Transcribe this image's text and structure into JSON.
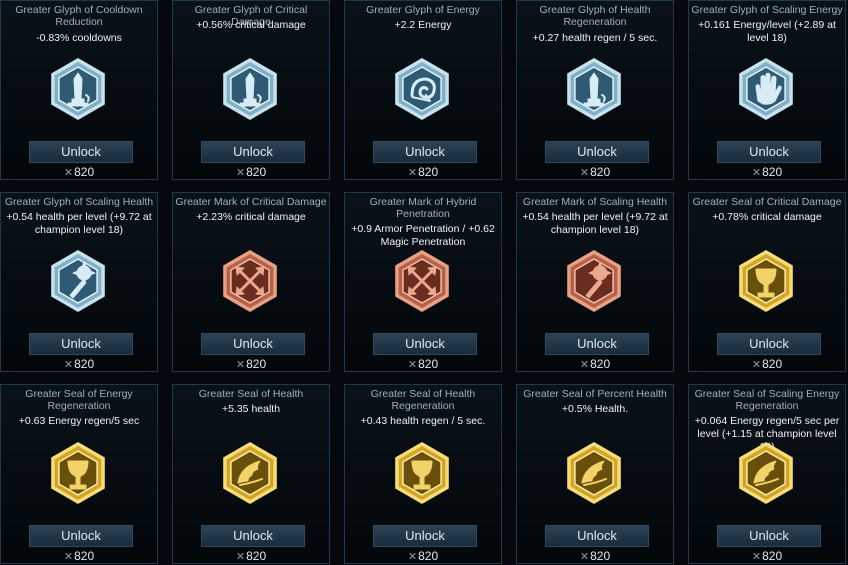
{
  "currency_symbol": "✕",
  "colors": {
    "glyph": "#8fc3d9",
    "mark": "#c26a4a",
    "seal": "#d4a92a"
  },
  "runes": [
    {
      "title": "Greater Glyph of Cooldown Reduction",
      "desc": "-0.83% cooldowns",
      "type": "glyph",
      "icon": "lighthouse-icon",
      "button": "Unlock",
      "price": "820"
    },
    {
      "title": "Greater Glyph of Critical Damage",
      "desc": "+0.56% critical damage",
      "type": "glyph",
      "icon": "lighthouse-icon",
      "button": "Unlock",
      "price": "820"
    },
    {
      "title": "Greater Glyph of Energy",
      "desc": "+2.2 Energy",
      "type": "glyph",
      "icon": "swirl-icon",
      "button": "Unlock",
      "price": "820"
    },
    {
      "title": "Greater Glyph of Health Regeneration",
      "desc": "+0.27 health regen / 5 sec.",
      "type": "glyph",
      "icon": "lighthouse-icon",
      "button": "Unlock",
      "price": "820"
    },
    {
      "title": "Greater Glyph of Scaling Energy",
      "desc": "+0.161 Energy/level (+2.89 at level 18)",
      "type": "glyph",
      "icon": "hand-icon",
      "button": "Unlock",
      "price": "820"
    },
    {
      "title": "Greater Glyph of Scaling Health",
      "desc": "+0.54 health per level (+9.72 at champion level 18)",
      "type": "glyph",
      "icon": "mace-icon",
      "button": "Unlock",
      "price": "820"
    },
    {
      "title": "Greater Mark of Critical Damage",
      "desc": "+2.23% critical damage",
      "type": "mark",
      "icon": "crossed-arrows-icon",
      "button": "Unlock",
      "price": "820"
    },
    {
      "title": "Greater Mark of Hybrid Penetration",
      "desc": "+0.9 Armor Penetration / +0.62 Magic Penetration",
      "type": "mark",
      "icon": "crossed-arrows-icon",
      "button": "Unlock",
      "price": "820"
    },
    {
      "title": "Greater Mark of Scaling Health",
      "desc": "+0.54 health per level (+9.72 at champion level 18)",
      "type": "mark",
      "icon": "mace-icon",
      "button": "Unlock",
      "price": "820"
    },
    {
      "title": "Greater Seal of Critical Damage",
      "desc": "+0.78% critical damage",
      "type": "seal",
      "icon": "chalice-icon",
      "button": "Unlock",
      "price": "820"
    },
    {
      "title": "Greater Seal of Energy Regeneration",
      "desc": "+0.63 Energy regen/5 sec",
      "type": "seal",
      "icon": "chalice-icon",
      "button": "Unlock",
      "price": "820"
    },
    {
      "title": "Greater Seal of Health",
      "desc": "+5.35 health",
      "type": "seal",
      "icon": "wing-icon",
      "button": "Unlock",
      "price": "820"
    },
    {
      "title": "Greater Seal of Health Regeneration",
      "desc": "+0.43 health regen / 5 sec.",
      "type": "seal",
      "icon": "chalice-icon",
      "button": "Unlock",
      "price": "820"
    },
    {
      "title": "Greater Seal of Percent Health",
      "desc": "+0.5% Health.",
      "type": "seal",
      "icon": "wing-icon",
      "button": "Unlock",
      "price": "820"
    },
    {
      "title": "Greater Seal of Scaling Energy Regeneration",
      "desc": "+0.064 Energy regen/5 sec per level (+1.15 at champion level 18)",
      "type": "seal",
      "icon": "wing-icon",
      "button": "Unlock",
      "price": "820"
    }
  ]
}
